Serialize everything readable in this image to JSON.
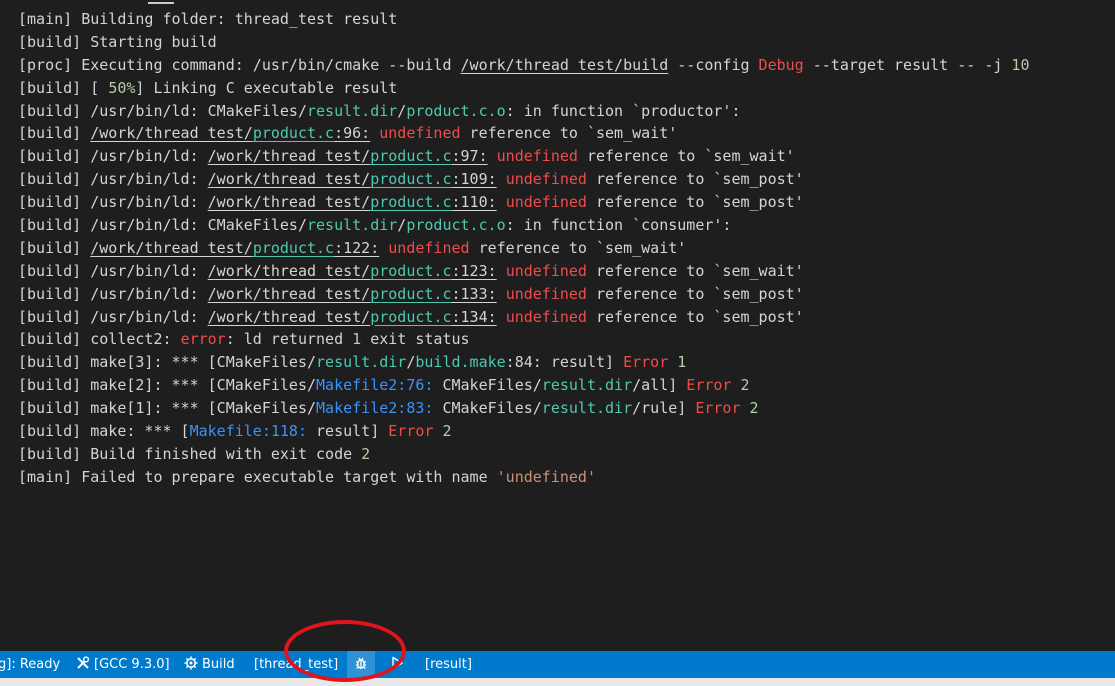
{
  "colors": {
    "background": "#1e1e1e",
    "text": "#d4d4d4",
    "path": "#4ec9b0",
    "error": "#f14c4c",
    "link": "#3794ff",
    "string": "#ce9178",
    "number": "#b5cea8",
    "statusbar": "#007acc",
    "annotation": "#e0141c"
  },
  "output": {
    "lines": [
      [
        [
          "[main] Building folder: thread_test result",
          "t"
        ]
      ],
      [
        [
          "[build] Starting build",
          "t"
        ]
      ],
      [
        [
          "[proc] Executing command: /usr/bin/cmake --build ",
          "t"
        ],
        [
          "/work/thread_test/build",
          "tu"
        ],
        [
          " --config ",
          "t"
        ],
        [
          "Debug",
          "e"
        ],
        [
          " --target result -- -j ",
          "t"
        ],
        [
          "10",
          "n"
        ]
      ],
      [
        [
          "[build] [ ",
          "t"
        ],
        [
          "50%",
          "n"
        ],
        [
          "] Linking C executable result",
          "t"
        ]
      ],
      [
        [
          "[build] /usr/bin/ld: CMakeFiles/",
          "t"
        ],
        [
          "result.dir",
          "p"
        ],
        [
          "/",
          "t"
        ],
        [
          "product.c.o",
          "p"
        ],
        [
          ": in function `productor':",
          "t"
        ]
      ],
      [
        [
          "[build] ",
          "t"
        ],
        [
          "/work/thread_test/",
          "tu"
        ],
        [
          "product.c",
          "pu"
        ],
        [
          ":96:",
          "tu"
        ],
        [
          " ",
          "t"
        ],
        [
          "undefined",
          "e"
        ],
        [
          " reference to `sem_wait'",
          "t"
        ]
      ],
      [
        [
          "[build] /usr/bin/ld: ",
          "t"
        ],
        [
          "/work/thread_test/",
          "tu"
        ],
        [
          "product.c",
          "pu"
        ],
        [
          ":97:",
          "tu"
        ],
        [
          " ",
          "t"
        ],
        [
          "undefined",
          "e"
        ],
        [
          " reference to `sem_wait'",
          "t"
        ]
      ],
      [
        [
          "[build] /usr/bin/ld: ",
          "t"
        ],
        [
          "/work/thread_test/",
          "tu"
        ],
        [
          "product.c",
          "pu"
        ],
        [
          ":109:",
          "tu"
        ],
        [
          " ",
          "t"
        ],
        [
          "undefined",
          "e"
        ],
        [
          " reference to `sem_post'",
          "t"
        ]
      ],
      [
        [
          "[build] /usr/bin/ld: ",
          "t"
        ],
        [
          "/work/thread_test/",
          "tu"
        ],
        [
          "product.c",
          "pu"
        ],
        [
          ":110:",
          "tu"
        ],
        [
          " ",
          "t"
        ],
        [
          "undefined",
          "e"
        ],
        [
          " reference to `sem_post'",
          "t"
        ]
      ],
      [
        [
          "[build] /usr/bin/ld: CMakeFiles/",
          "t"
        ],
        [
          "result.dir",
          "p"
        ],
        [
          "/",
          "t"
        ],
        [
          "product.c.o",
          "p"
        ],
        [
          ": in function `consumer':",
          "t"
        ]
      ],
      [
        [
          "[build] ",
          "t"
        ],
        [
          "/work/thread_test/",
          "tu"
        ],
        [
          "product.c",
          "pu"
        ],
        [
          ":122:",
          "tu"
        ],
        [
          " ",
          "t"
        ],
        [
          "undefined",
          "e"
        ],
        [
          " reference to `sem_wait'",
          "t"
        ]
      ],
      [
        [
          "[build] /usr/bin/ld: ",
          "t"
        ],
        [
          "/work/thread_test/",
          "tu"
        ],
        [
          "product.c",
          "pu"
        ],
        [
          ":123:",
          "tu"
        ],
        [
          " ",
          "t"
        ],
        [
          "undefined",
          "e"
        ],
        [
          " reference to `sem_wait'",
          "t"
        ]
      ],
      [
        [
          "[build] /usr/bin/ld: ",
          "t"
        ],
        [
          "/work/thread_test/",
          "tu"
        ],
        [
          "product.c",
          "pu"
        ],
        [
          ":133:",
          "tu"
        ],
        [
          " ",
          "t"
        ],
        [
          "undefined",
          "e"
        ],
        [
          " reference to `sem_post'",
          "t"
        ]
      ],
      [
        [
          "[build] /usr/bin/ld: ",
          "t"
        ],
        [
          "/work/thread_test/",
          "tu"
        ],
        [
          "product.c",
          "pu"
        ],
        [
          ":134:",
          "tu"
        ],
        [
          " ",
          "t"
        ],
        [
          "undefined",
          "e"
        ],
        [
          " reference to `sem_post'",
          "t"
        ]
      ],
      [
        [
          "[build] collect2: ",
          "t"
        ],
        [
          "error",
          "e"
        ],
        [
          ": ld returned ",
          "t"
        ],
        [
          "1",
          "n"
        ],
        [
          " exit status",
          "t"
        ]
      ],
      [
        [
          "[build] make[3]: *** [CMakeFiles/",
          "t"
        ],
        [
          "result.dir",
          "p"
        ],
        [
          "/",
          "t"
        ],
        [
          "build.make",
          "p"
        ],
        [
          ":84: result] ",
          "t"
        ],
        [
          "Error",
          "e"
        ],
        [
          " ",
          "t"
        ],
        [
          "1",
          "n"
        ]
      ],
      [
        [
          "[build] make[2]: *** [CMakeFiles/",
          "t"
        ],
        [
          "Makefile2:76:",
          "l"
        ],
        [
          " CMakeFiles/",
          "t"
        ],
        [
          "result.dir",
          "p"
        ],
        [
          "/all] ",
          "t"
        ],
        [
          "Error",
          "e"
        ],
        [
          " ",
          "t"
        ],
        [
          "2",
          "n"
        ]
      ],
      [
        [
          "[build] make[1]: *** [CMakeFiles/",
          "t"
        ],
        [
          "Makefile2:83:",
          "l"
        ],
        [
          " CMakeFiles/",
          "t"
        ],
        [
          "result.dir",
          "p"
        ],
        [
          "/rule] ",
          "t"
        ],
        [
          "Error",
          "e"
        ],
        [
          " ",
          "t"
        ],
        [
          "2",
          "n"
        ]
      ],
      [
        [
          "[build] make: *** [",
          "t"
        ],
        [
          "Makefile:118:",
          "l"
        ],
        [
          " result] ",
          "t"
        ],
        [
          "Error",
          "e"
        ],
        [
          " ",
          "t"
        ],
        [
          "2",
          "n"
        ]
      ],
      [
        [
          "[build] Build finished with exit code ",
          "t"
        ],
        [
          "2",
          "n"
        ]
      ],
      [
        [
          "[main] Failed to prepare executable target with name ",
          "t"
        ],
        [
          "'undefined'",
          "s"
        ]
      ]
    ]
  },
  "statusbar": {
    "status_label": "g]: Ready",
    "kit_icon": "tools-icon",
    "kit_label": "[GCC 9.3.0]",
    "build_icon": "gear-icon",
    "build_label": "Build",
    "target_label": "[thread_test]",
    "debug_icon": "bug-icon",
    "run_icon": "play-icon",
    "launch_target_label": "[result]"
  }
}
